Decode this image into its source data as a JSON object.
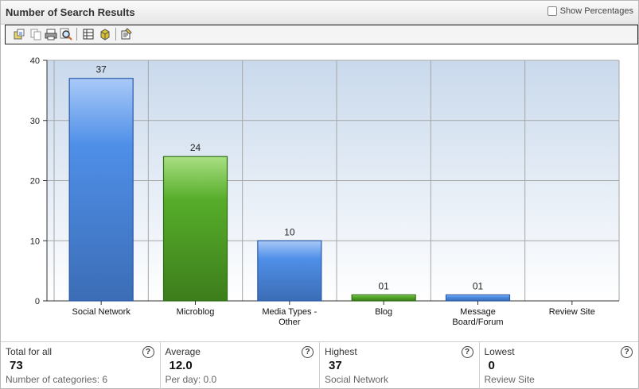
{
  "window": {
    "title": "Number of Search Results",
    "show_percentages_label": "Show Percentages"
  },
  "toolbar": {
    "icons": [
      "export-icon",
      "copy-icon",
      "print-icon",
      "zoom-icon",
      "table-view-icon",
      "3d-view-icon",
      "properties-icon"
    ]
  },
  "chart_data": {
    "type": "bar",
    "categories": [
      "Social Network",
      "Microblog",
      "Media Types - Other",
      "Blog",
      "Message Board/Forum",
      "Review Site"
    ],
    "category_lines": [
      [
        "Social Network"
      ],
      [
        "Microblog"
      ],
      [
        "Media Types -",
        "Other"
      ],
      [
        "Blog"
      ],
      [
        "Message",
        "Board/Forum"
      ],
      [
        "Review Site"
      ]
    ],
    "values": [
      37,
      24,
      10,
      1,
      1,
      0
    ],
    "data_labels": [
      "37",
      "24",
      "10",
      "01",
      "01",
      ""
    ],
    "colors": [
      "#4f8fe8",
      "#56ad2a",
      "#4f8fe8",
      "#56ad2a",
      "#4f8fe8",
      "#56ad2a"
    ],
    "ylim": [
      0,
      40
    ],
    "yticks": [
      0,
      10,
      20,
      30,
      40
    ],
    "grid": true
  },
  "stats": [
    {
      "label": "Total for all",
      "value": "73",
      "sub": "Number of categories: 6"
    },
    {
      "label": "Average",
      "value": "12.0",
      "sub": "Per day: 0.0"
    },
    {
      "label": "Highest",
      "value": "37",
      "sub": "Social Network"
    },
    {
      "label": "Lowest",
      "value": "0",
      "sub": "Review Site"
    }
  ],
  "help_glyph": "?"
}
